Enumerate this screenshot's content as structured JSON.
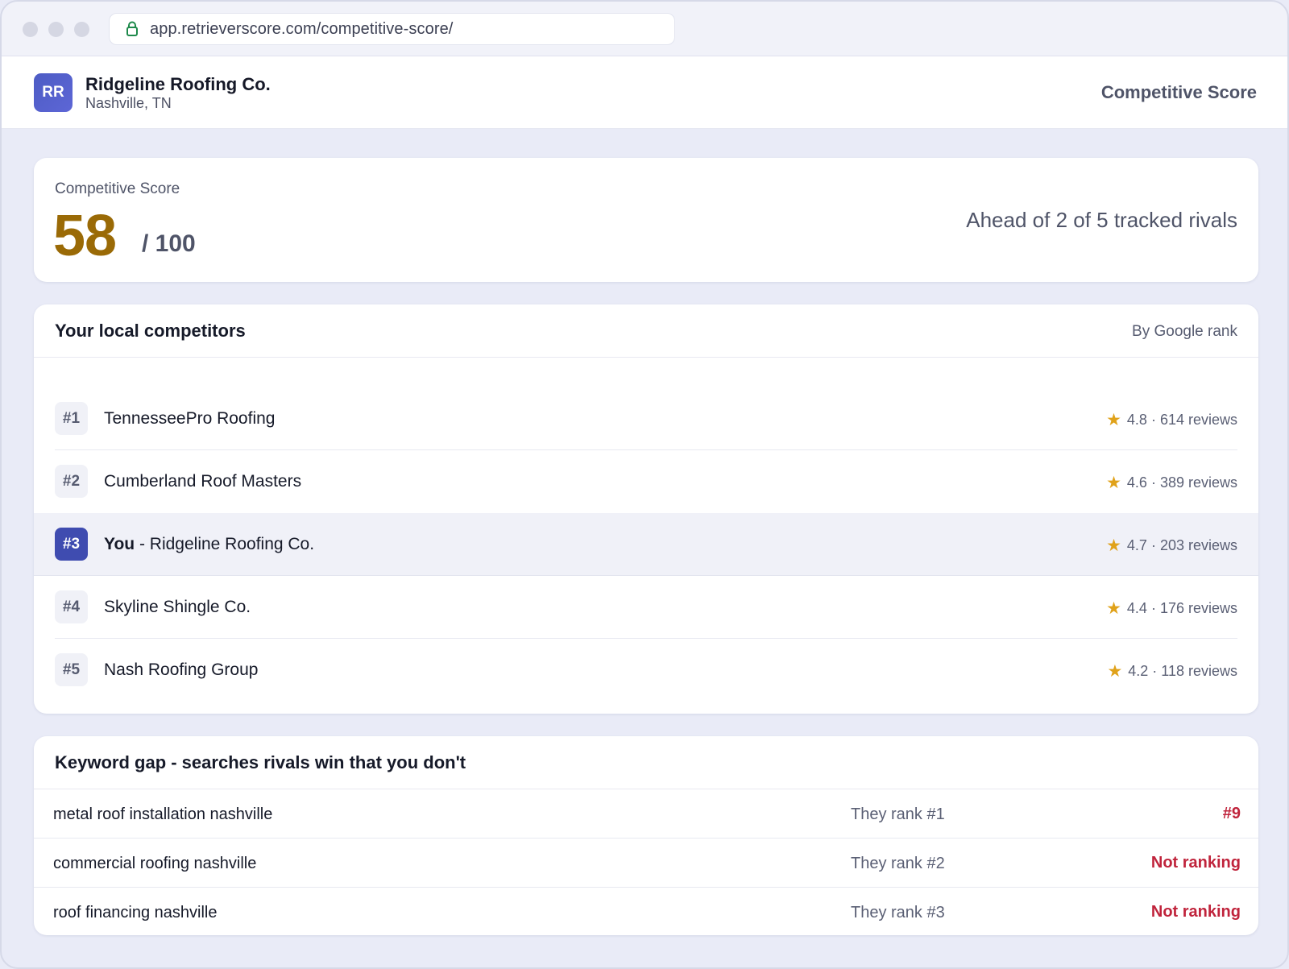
{
  "browser": {
    "url": "app.retrieverscore.com/competitive-score/"
  },
  "header": {
    "avatar_initials": "RR",
    "business_name": "Ridgeline Roofing Co.",
    "location": "Nashville, TN",
    "page_title": "Competitive Score"
  },
  "score": {
    "label": "Competitive Score",
    "value": "58",
    "max": "/ 100",
    "summary": "Ahead of 2 of 5 tracked rivals"
  },
  "competitors": {
    "title": "Your local competitors",
    "sort_label": "By Google rank",
    "rows": [
      {
        "rank": "#1",
        "name": "TennesseePro Roofing",
        "rating": "4.8 · 614 reviews"
      },
      {
        "rank": "#2",
        "name": "Cumberland Roof Masters",
        "rating": "4.6 · 389 reviews"
      },
      {
        "rank": "#3",
        "you_label": "You",
        "separator": " - ",
        "name": "Ridgeline Roofing Co.",
        "rating": "4.7 · 203 reviews"
      },
      {
        "rank": "#4",
        "name": "Skyline Shingle Co.",
        "rating": "4.4 · 176 reviews"
      },
      {
        "rank": "#5",
        "name": "Nash Roofing Group",
        "rating": "4.2 · 118 reviews"
      }
    ]
  },
  "keyword_gap": {
    "title": "Keyword gap - searches rivals win that you don't",
    "rows": [
      {
        "term": "metal roof installation nashville",
        "their_rank": "They rank #1",
        "your_rank": "#9"
      },
      {
        "term": "commercial roofing nashville",
        "their_rank": "They rank #2",
        "your_rank": "Not ranking"
      },
      {
        "term": "roof financing nashville",
        "their_rank": "They rank #3",
        "your_rank": "Not ranking"
      }
    ]
  },
  "icons": {
    "lock": "lock-icon",
    "star": "★"
  },
  "colors": {
    "score": "#9a6a06",
    "accent": "#3f4cb0",
    "negative": "#c0243c",
    "star": "#e0a21a"
  }
}
